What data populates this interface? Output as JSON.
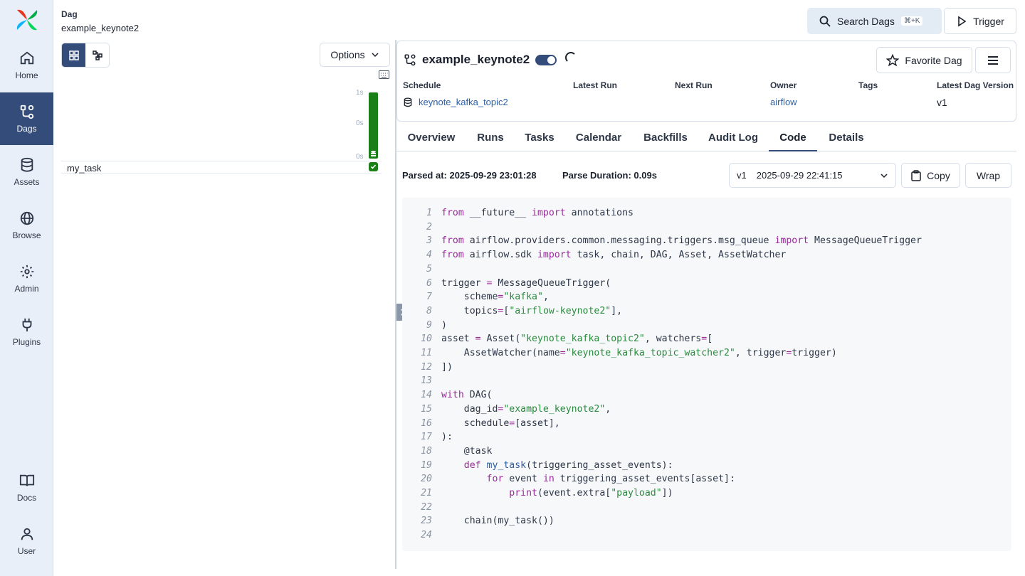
{
  "sidebar": {
    "items": [
      {
        "label": "Home",
        "icon": "home-icon"
      },
      {
        "label": "Dags",
        "icon": "dags-icon",
        "active": true
      },
      {
        "label": "Assets",
        "icon": "database-icon"
      },
      {
        "label": "Browse",
        "icon": "globe-icon"
      },
      {
        "label": "Admin",
        "icon": "gear-icon"
      },
      {
        "label": "Plugins",
        "icon": "plug-icon"
      }
    ],
    "bottom_items": [
      {
        "label": "Docs",
        "icon": "book-icon"
      },
      {
        "label": "User",
        "icon": "user-icon"
      }
    ]
  },
  "breadcrumb": {
    "label": "Dag",
    "name": "example_keynote2"
  },
  "left_panel": {
    "options_label": "Options",
    "ticks": [
      "1s",
      "0s",
      "0s"
    ],
    "task_name": "my_task",
    "run_state": "success"
  },
  "topbar": {
    "search_label": "Search Dags",
    "search_shortcut": "⌘+K",
    "trigger_label": "Trigger"
  },
  "dag": {
    "title": "example_keynote2",
    "favorite_label": "Favorite Dag",
    "meta_headers": {
      "schedule": "Schedule",
      "latest_run": "Latest Run",
      "next_run": "Next Run",
      "owner": "Owner",
      "tags": "Tags",
      "latest_version": "Latest Dag Version"
    },
    "schedule_value": "keynote_kafka_topic2",
    "owner_value": "airflow",
    "version_value": "v1"
  },
  "tabs": [
    "Overview",
    "Runs",
    "Tasks",
    "Calendar",
    "Backfills",
    "Audit Log",
    "Code",
    "Details"
  ],
  "active_tab": "Code",
  "code_header": {
    "parsed_at": "Parsed at: 2025-09-29 23:01:28",
    "parse_duration": "Parse Duration: 0.09s",
    "version": "v1",
    "version_date": "2025-09-29 22:41:15",
    "copy_label": "Copy",
    "wrap_label": "Wrap"
  },
  "code_lines": [
    [
      [
        "kw",
        "from"
      ],
      [
        "t",
        " __future__ "
      ],
      [
        "kw",
        "import"
      ],
      [
        "t",
        " annotations"
      ]
    ],
    [],
    [
      [
        "kw",
        "from"
      ],
      [
        "t",
        " airflow.providers.common.messaging.triggers.msg_queue "
      ],
      [
        "kw",
        "import"
      ],
      [
        "t",
        " MessageQueueTrigger"
      ]
    ],
    [
      [
        "kw",
        "from"
      ],
      [
        "t",
        " airflow.sdk "
      ],
      [
        "kw",
        "import"
      ],
      [
        "t",
        " task, chain, DAG, Asset, AssetWatcher"
      ]
    ],
    [],
    [
      [
        "t",
        "trigger "
      ],
      [
        "kw",
        "="
      ],
      [
        "t",
        " MessageQueueTrigger("
      ]
    ],
    [
      [
        "t",
        "    scheme"
      ],
      [
        "kw",
        "="
      ],
      [
        "str",
        "\"kafka\""
      ],
      [
        "t",
        ","
      ]
    ],
    [
      [
        "t",
        "    topics"
      ],
      [
        "kw",
        "="
      ],
      [
        "t",
        "["
      ],
      [
        "str",
        "\"airflow-keynote2\""
      ],
      [
        "t",
        "],"
      ]
    ],
    [
      [
        "t",
        ")"
      ]
    ],
    [
      [
        "t",
        "asset "
      ],
      [
        "kw",
        "="
      ],
      [
        "t",
        " Asset("
      ],
      [
        "str",
        "\"keynote_kafka_topic2\""
      ],
      [
        "t",
        ", watchers"
      ],
      [
        "kw",
        "="
      ],
      [
        "t",
        "["
      ]
    ],
    [
      [
        "t",
        "    AssetWatcher(name"
      ],
      [
        "kw",
        "="
      ],
      [
        "str",
        "\"keynote_kafka_topic_watcher2\""
      ],
      [
        "t",
        ", trigger"
      ],
      [
        "kw",
        "="
      ],
      [
        "t",
        "trigger)"
      ]
    ],
    [
      [
        "t",
        "])"
      ]
    ],
    [],
    [
      [
        "kw",
        "with"
      ],
      [
        "t",
        " DAG("
      ]
    ],
    [
      [
        "t",
        "    dag_id"
      ],
      [
        "kw",
        "="
      ],
      [
        "str",
        "\"example_keynote2\""
      ],
      [
        "t",
        ","
      ]
    ],
    [
      [
        "t",
        "    schedule"
      ],
      [
        "kw",
        "="
      ],
      [
        "t",
        "[asset],"
      ]
    ],
    [
      [
        "t",
        "):"
      ]
    ],
    [
      [
        "t",
        "    @task"
      ]
    ],
    [
      [
        "t",
        "    "
      ],
      [
        "kw",
        "def"
      ],
      [
        "t",
        " "
      ],
      [
        "fn",
        "my_task"
      ],
      [
        "t",
        "(triggering_asset_events):"
      ]
    ],
    [
      [
        "t",
        "        "
      ],
      [
        "kw",
        "for"
      ],
      [
        "t",
        " event "
      ],
      [
        "kw",
        "in"
      ],
      [
        "t",
        " triggering_asset_events[asset]:"
      ]
    ],
    [
      [
        "t",
        "            "
      ],
      [
        "kw",
        "print"
      ],
      [
        "t",
        "(event.extra["
      ],
      [
        "str",
        "\"payload\""
      ],
      [
        "t",
        "])"
      ]
    ],
    [],
    [
      [
        "t",
        "    chain(my_task())"
      ]
    ],
    []
  ]
}
